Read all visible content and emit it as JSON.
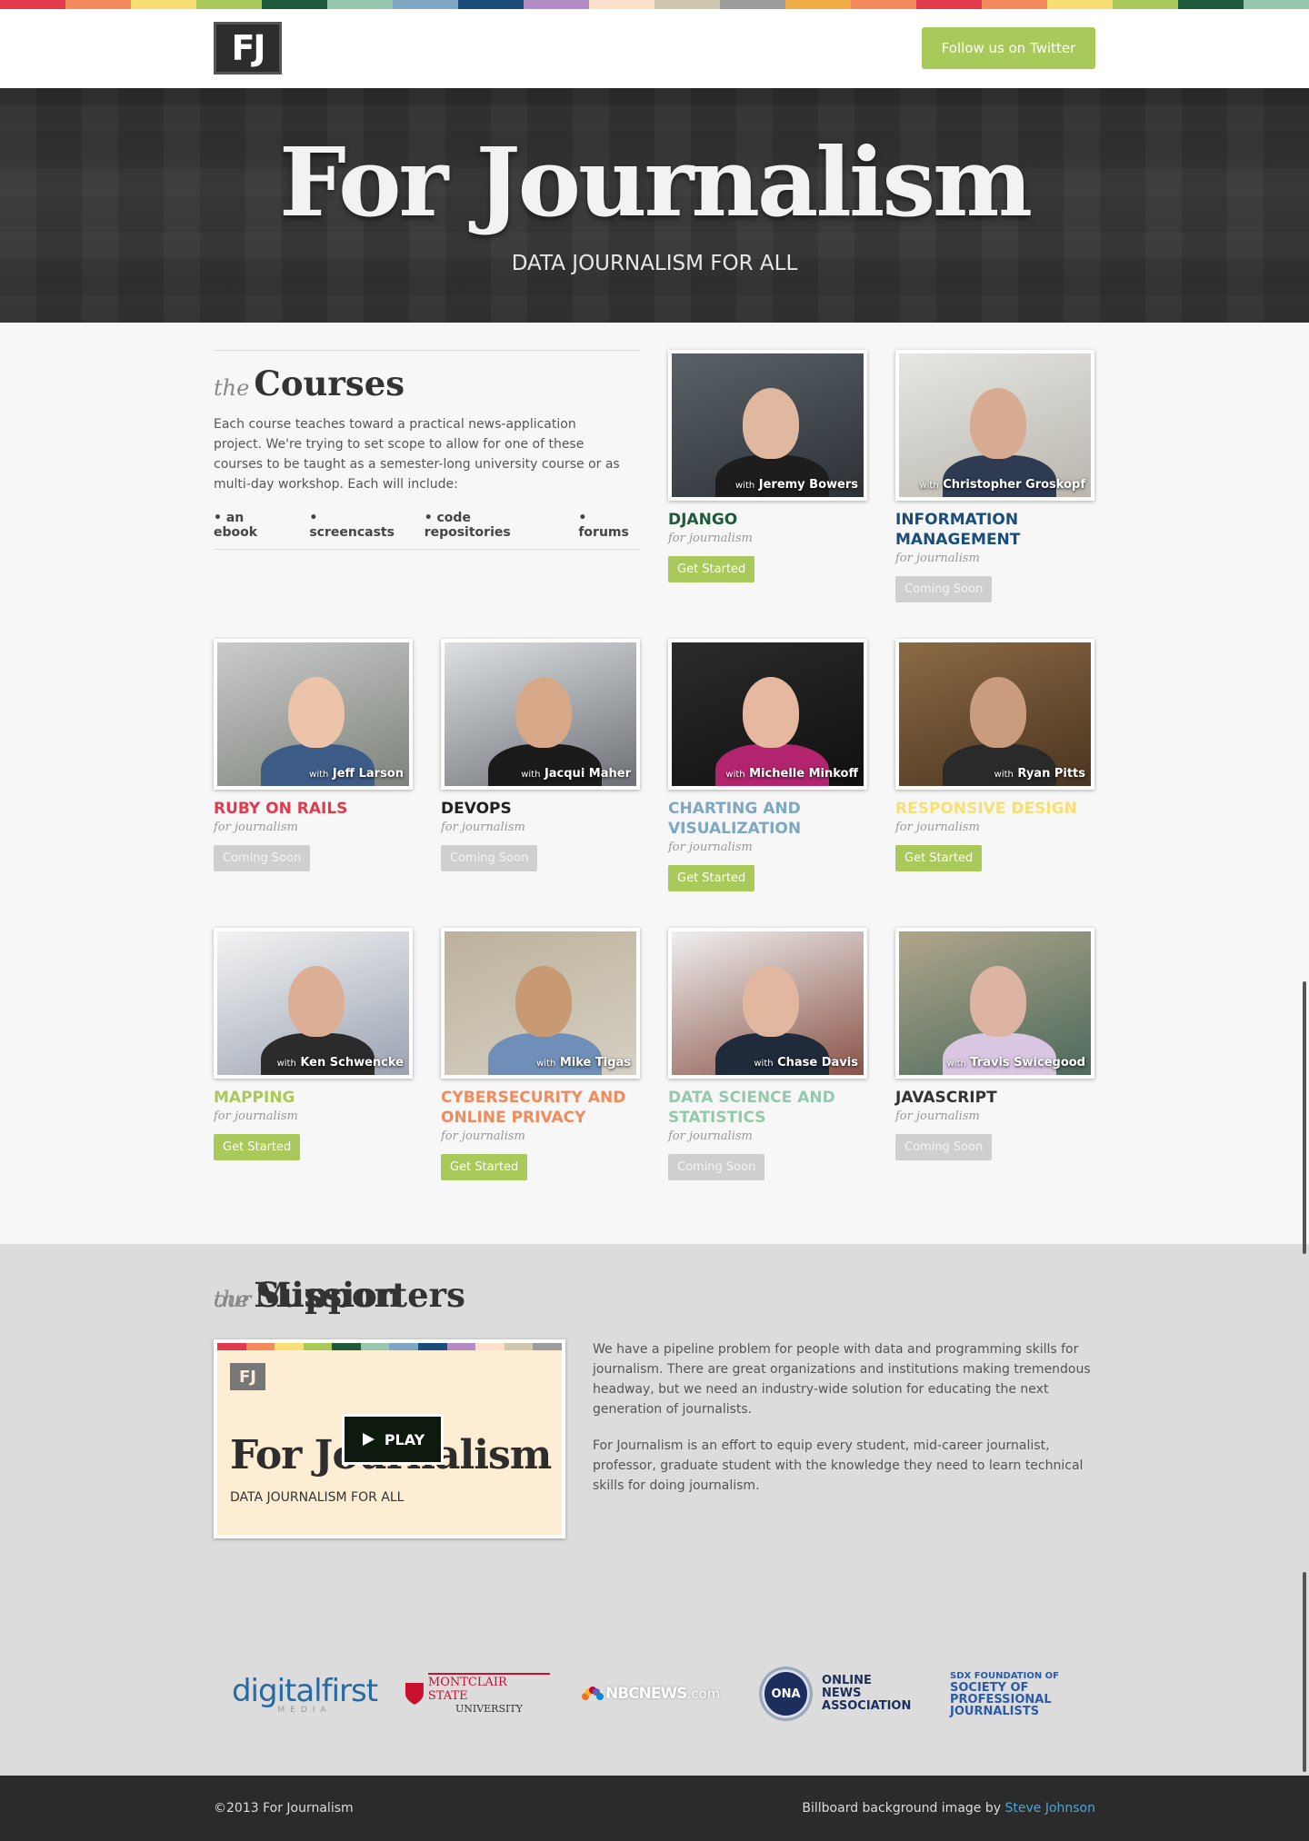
{
  "stripe_colors": [
    "#e13a4d",
    "#f38a5c",
    "#f8df74",
    "#a9c95a",
    "#1f5a3a",
    "#96c8ad",
    "#7da7c3",
    "#1a4c7c",
    "#b38cc4",
    "#fde0cc",
    "#cfc8ae",
    "#9c9c9c",
    "#f0ad48",
    "#f38a5c",
    "#e13a4d",
    "#f38a5c",
    "#f8df74",
    "#a9c95a",
    "#1f5a3a",
    "#96c8ad"
  ],
  "header": {
    "logo": "FJ",
    "twitter_label": "Follow us on Twitter"
  },
  "billboard": {
    "title": "For Journalism",
    "subtitle": "DATA JOURNALISM FOR ALL"
  },
  "courses": {
    "title_prefix": "the",
    "title": "Courses",
    "intro": "Each course teaches toward a practical news-application project. We're trying to set scope to allow for one of these courses to be taught as a semester-long university course or as multi-day workshop. Each will include:",
    "includes": [
      "• an ebook",
      "• screencasts",
      "• code repositories",
      "• forums"
    ],
    "items": [
      {
        "instructor": "Jeremy Bowers",
        "with": "with",
        "title": "Django",
        "sub": "for journalism",
        "button": "Get Started",
        "status": "go",
        "color": "#1f5a3a"
      },
      {
        "instructor": "Christopher Groskopf",
        "with": "with",
        "title": "Information Management",
        "sub": "for journalism",
        "button": "Coming Soon",
        "status": "soon",
        "color": "#1a4c7c"
      },
      {
        "instructor": "Jeff Larson",
        "with": "with",
        "title": "Ruby on Rails",
        "sub": "for journalism",
        "button": "Coming Soon",
        "status": "soon",
        "color": "#e13a4d"
      },
      {
        "instructor": "Jacqui Maher",
        "with": "with",
        "title": "DevOps",
        "sub": "for journalism",
        "button": "Coming Soon",
        "status": "soon",
        "color": "#222222"
      },
      {
        "instructor": "Michelle Minkoff",
        "with": "with",
        "title": "Charting and Visualization",
        "sub": "for journalism",
        "button": "Get Started",
        "status": "go",
        "color": "#7da7c3"
      },
      {
        "instructor": "Ryan Pitts",
        "with": "with",
        "title": "Responsive Design",
        "sub": "for journalism",
        "button": "Get Started",
        "status": "go",
        "color": "#f8df74"
      },
      {
        "instructor": "Ken Schwencke",
        "with": "with",
        "title": "Mapping",
        "sub": "for journalism",
        "button": "Get Started",
        "status": "go",
        "color": "#a9c95a"
      },
      {
        "instructor": "Mike Tigas",
        "with": "with",
        "title": "Cybersecurity and Online Privacy",
        "sub": "for journalism",
        "button": "Get Started",
        "status": "go",
        "color": "#f38a5c"
      },
      {
        "instructor": "Chase Davis",
        "with": "with",
        "title": "Data Science and Statistics",
        "sub": "for journalism",
        "button": "Coming Soon",
        "status": "soon",
        "color": "#96c8ad"
      },
      {
        "instructor": "Travis Swicegood",
        "with": "with",
        "title": "JavaScript",
        "sub": "for journalism",
        "button": "Coming Soon",
        "status": "soon",
        "color": "#333333"
      }
    ]
  },
  "mission": {
    "title_prefix": "the",
    "title": "Mission",
    "video": {
      "logo": "FJ",
      "title": "For Journalism",
      "subtitle": "DATA JOURNALISM FOR ALL",
      "play": "PLAY"
    },
    "paragraphs": [
      "We have a pipeline problem for people with data and programming skills for journalism. There are great organizations and institutions making tremendous headway, but we need an industry-wide solution for educating the next generation of journalists.",
      "For Journalism is an effort to equip every student, mid-career journalist, professor, graduate student with the knowledge they need to learn technical skills for doing journalism."
    ]
  },
  "supporters": {
    "title_prefix": "our",
    "title": "Supporters",
    "logos": {
      "dfm_main": "digitalfirst",
      "dfm_sub": "MEDIA",
      "msu_main": "MONTCLAIR STATE",
      "msu_sub": "UNIVERSITY",
      "nbc_main": "NBCNEWS",
      "nbc_sub": ".com",
      "ona_badge": "ONA",
      "ona_line1": "ONLINE NEWS",
      "ona_line2": "ASSOCIATION",
      "spj_line1": "SDX FOUNDATION OF",
      "spj_line2": "SOCIETY OF",
      "spj_line3": "PROFESSIONAL",
      "spj_line4": "JOURNALISTS"
    }
  },
  "footer": {
    "copyright": "©2013 For Journalism",
    "credit_prefix": "Billboard background image by",
    "credit_link": "Steve Johnson"
  }
}
